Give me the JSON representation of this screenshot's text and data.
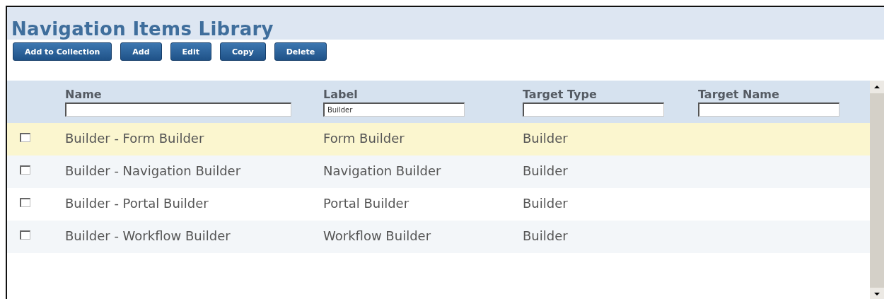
{
  "title": "Navigation Items Library",
  "buttons": [
    "Add to Collection",
    "Add",
    "Edit",
    "Copy",
    "Delete"
  ],
  "columns": [
    {
      "label": "Name"
    },
    {
      "label": "Label",
      "filter": "Builder"
    },
    {
      "label": "Target Type"
    },
    {
      "label": "Target Name"
    }
  ],
  "rows": [
    {
      "selected": true,
      "checked": false,
      "cells": [
        "Builder - Form Builder",
        "Form Builder",
        "Builder"
      ]
    },
    {
      "selected": false,
      "checked": false,
      "cells": [
        "Builder - Navigation Builder",
        "Navigation Builder",
        "Builder"
      ]
    },
    {
      "selected": false,
      "checked": false,
      "cells": [
        "Builder - Portal Builder",
        "Portal Builder",
        "Builder"
      ]
    },
    {
      "selected": false,
      "checked": false,
      "cells": [
        "Builder - Workflow Builder",
        "Workflow Builder",
        "Builder"
      ]
    }
  ]
}
